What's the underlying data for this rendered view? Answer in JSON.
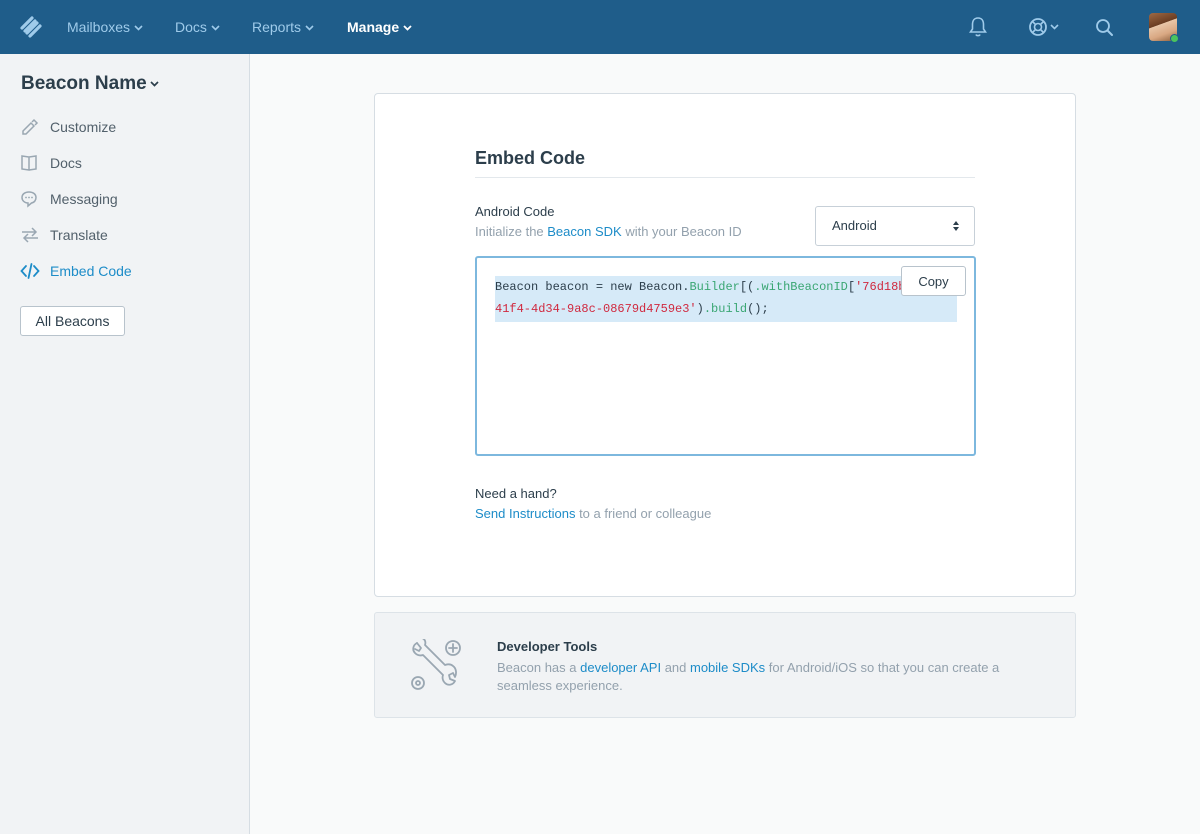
{
  "topnav": {
    "items": [
      {
        "label": "Mailboxes"
      },
      {
        "label": "Docs"
      },
      {
        "label": "Reports"
      },
      {
        "label": "Manage"
      }
    ],
    "icons": [
      "bell-icon",
      "help-lifebuoy-icon",
      "search-icon",
      "avatar"
    ]
  },
  "sidebar": {
    "title": "Beacon Name",
    "items": [
      {
        "label": "Customize",
        "icon": "brush-icon"
      },
      {
        "label": "Docs",
        "icon": "book-icon"
      },
      {
        "label": "Messaging",
        "icon": "chat-icon"
      },
      {
        "label": "Translate",
        "icon": "swap-arrows-icon"
      },
      {
        "label": "Embed Code",
        "icon": "code-icon"
      }
    ],
    "all_beacons": "All Beacons"
  },
  "embed": {
    "title": "Embed Code",
    "field_label": "Android Code",
    "help_before": "Initialize the ",
    "help_link": "Beacon SDK",
    "help_after": " with your Beacon ID",
    "platform_value": "Android",
    "code": {
      "l1_plain": "Beacon beacon = new Beacon.",
      "l1_builder": "Builder",
      "l1_paren": "[(",
      "l1_method": ".withBeaconID",
      "l1_bracket": "[",
      "l1_str": "'76d18b",
      "l2_str": "41f4-4d34-9a8c-08679d4759e3'",
      "l2_close": ")",
      "l2_build": ".build",
      "l2_end": "();"
    },
    "copy_label": "Copy",
    "need_hand": "Need a hand?",
    "send_link": "Send Instructions",
    "send_after": " to a friend or colleague"
  },
  "dev_tools": {
    "title": "Developer Tools",
    "text_1": "Beacon has a ",
    "link_api": "developer API",
    "text_2": " and ",
    "link_sdk": "mobile SDKs",
    "text_3": " for Android/iOS so that you can create a seamless experience."
  },
  "colors": {
    "nav_bg": "#1f5d8a",
    "accent": "#1d8cc8",
    "code_green": "#3aa673",
    "code_red": "#d0293f"
  }
}
